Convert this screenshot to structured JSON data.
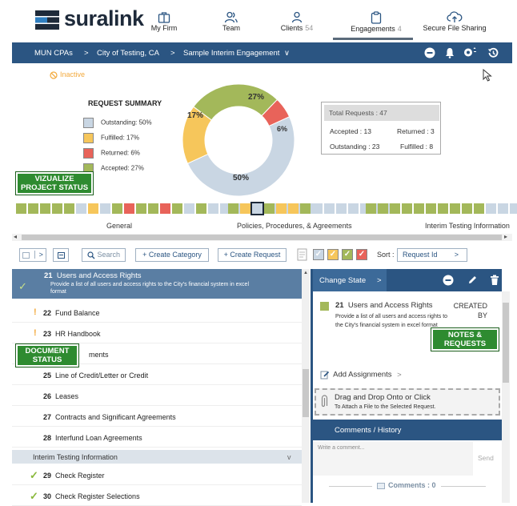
{
  "brand": {
    "name": "suralink"
  },
  "nav": {
    "items": [
      {
        "label": "My Firm",
        "count": "",
        "icon": "briefcase-icon"
      },
      {
        "label": "Team",
        "count": "",
        "icon": "team-icon"
      },
      {
        "label": "Clients",
        "count": "54",
        "icon": "user-icon"
      },
      {
        "label": "Engagements",
        "count": "4",
        "icon": "clipboard-icon"
      },
      {
        "label": "Secure File Sharing",
        "count": "",
        "icon": "cloud-upload-icon"
      }
    ],
    "active": "Engagements"
  },
  "breadcrumb": {
    "items": [
      "MUN CPAs",
      "City of Testing, CA",
      "Sample Interim Engagement"
    ],
    "separator": ">",
    "dropdown": "∨"
  },
  "status": {
    "inactive": "Inactive"
  },
  "summary": {
    "title": "REQUEST SUMMARY",
    "legend": [
      {
        "label": "Outstanding: 50%",
        "color": "#c9d6e3"
      },
      {
        "label": "Fulfilled: 17%",
        "color": "#f6c65b"
      },
      {
        "label": "Returned: 6%",
        "color": "#e8635a"
      },
      {
        "label": "Accepted: 27%",
        "color": "#a3b85a"
      }
    ],
    "donut_labels": {
      "accepted": "27%",
      "fulfilled": "17%",
      "returned": "6%",
      "outstanding": "50%"
    },
    "totals": {
      "header": "Total Requests : 47",
      "accepted": "Accepted : 13",
      "returned": "Returned : 3",
      "outstanding": "Outstanding : 23",
      "fulfilled": "Fulfilled : 8"
    }
  },
  "chart_data": {
    "type": "pie",
    "categories": [
      "Outstanding",
      "Fulfilled",
      "Returned",
      "Accepted"
    ],
    "values": [
      50,
      17,
      6,
      27
    ],
    "colors": [
      "#c9d6e3",
      "#f6c65b",
      "#e8635a",
      "#a3b85a"
    ],
    "title": "REQUEST SUMMARY"
  },
  "callouts": {
    "visualize": "VIZUALIZE\nPROJECT STATUS",
    "document": "DOCUMENT\nSTATUS",
    "notes": "NOTES &\nREQUESTS"
  },
  "strip": {
    "groups": [
      {
        "label": "General",
        "segments": [
          "a",
          "a",
          "a",
          "a",
          "a",
          "b",
          "f",
          "b",
          "a",
          "r",
          "a",
          "a",
          "r",
          "a",
          "b",
          "a",
          "b",
          "b",
          "b",
          "b",
          "b",
          "b",
          "b",
          "b",
          "b"
        ]
      },
      {
        "label": "Policies, Procedures, & Agreements",
        "segments": [
          "a",
          "f",
          "b",
          "a",
          "f",
          "f",
          "a",
          "b",
          "b",
          "b",
          "b",
          "b",
          "b",
          "b"
        ]
      },
      {
        "label": "Interim Testing Information",
        "segments": [
          "a",
          "a",
          "a",
          "a",
          "a",
          "a",
          "a",
          "a",
          "a",
          "a",
          "b",
          "b",
          "b",
          "b"
        ]
      }
    ],
    "colors": {
      "a": "#a3b85a",
      "f": "#f6c65b",
      "r": "#e8635a",
      "b": "#c9d6e3"
    }
  },
  "toolbar": {
    "search": "Search",
    "create_category": "+ Create Category",
    "create_request": "+ Create Request",
    "sort_label": "Sort :",
    "sort_value": "Request Id",
    "sort_caret": ">"
  },
  "list": {
    "selected": {
      "number": "21",
      "title": "Users and Access Rights",
      "desc": "Provide a list of all users and access rights to the City's financial system in excel format"
    },
    "rows": [
      {
        "number": "22",
        "title": "Fund Balance",
        "state": "warn"
      },
      {
        "number": "23",
        "title": "HR Handbook",
        "state": "warn"
      },
      {
        "number": "24",
        "title": "ments",
        "state": "none"
      },
      {
        "number": "25",
        "title": "Line of Credit/Letter or Credit",
        "state": "none"
      },
      {
        "number": "26",
        "title": "Leases",
        "state": "none"
      },
      {
        "number": "27",
        "title": "Contracts and Significant Agreements",
        "state": "none"
      },
      {
        "number": "28",
        "title": "Interfund Loan Agreements",
        "state": "none"
      }
    ],
    "section": "Interim Testing Information",
    "section_caret": "v",
    "rows2": [
      {
        "number": "29",
        "title": "Check Register",
        "state": "done"
      },
      {
        "number": "30",
        "title": "Check Register Selections",
        "state": "done"
      }
    ]
  },
  "detail": {
    "change_state": "Change State",
    "caret": ">",
    "request_number": "21",
    "request_title": "Users and Access Rights",
    "request_desc": "Provide a list of all users and access rights to the City's financial system in excel format",
    "created_by": "CREATED BY",
    "add_assignments": "Add Assignments",
    "add_caret": ">",
    "drop_title": "Drag and Drop Onto or Click",
    "drop_sub": "To Attach a File to the Selected Request.",
    "tabs": "Comments / History",
    "comment_placeholder": "Write a comment...",
    "send": "Send",
    "comments_count": "Comments : 0"
  }
}
